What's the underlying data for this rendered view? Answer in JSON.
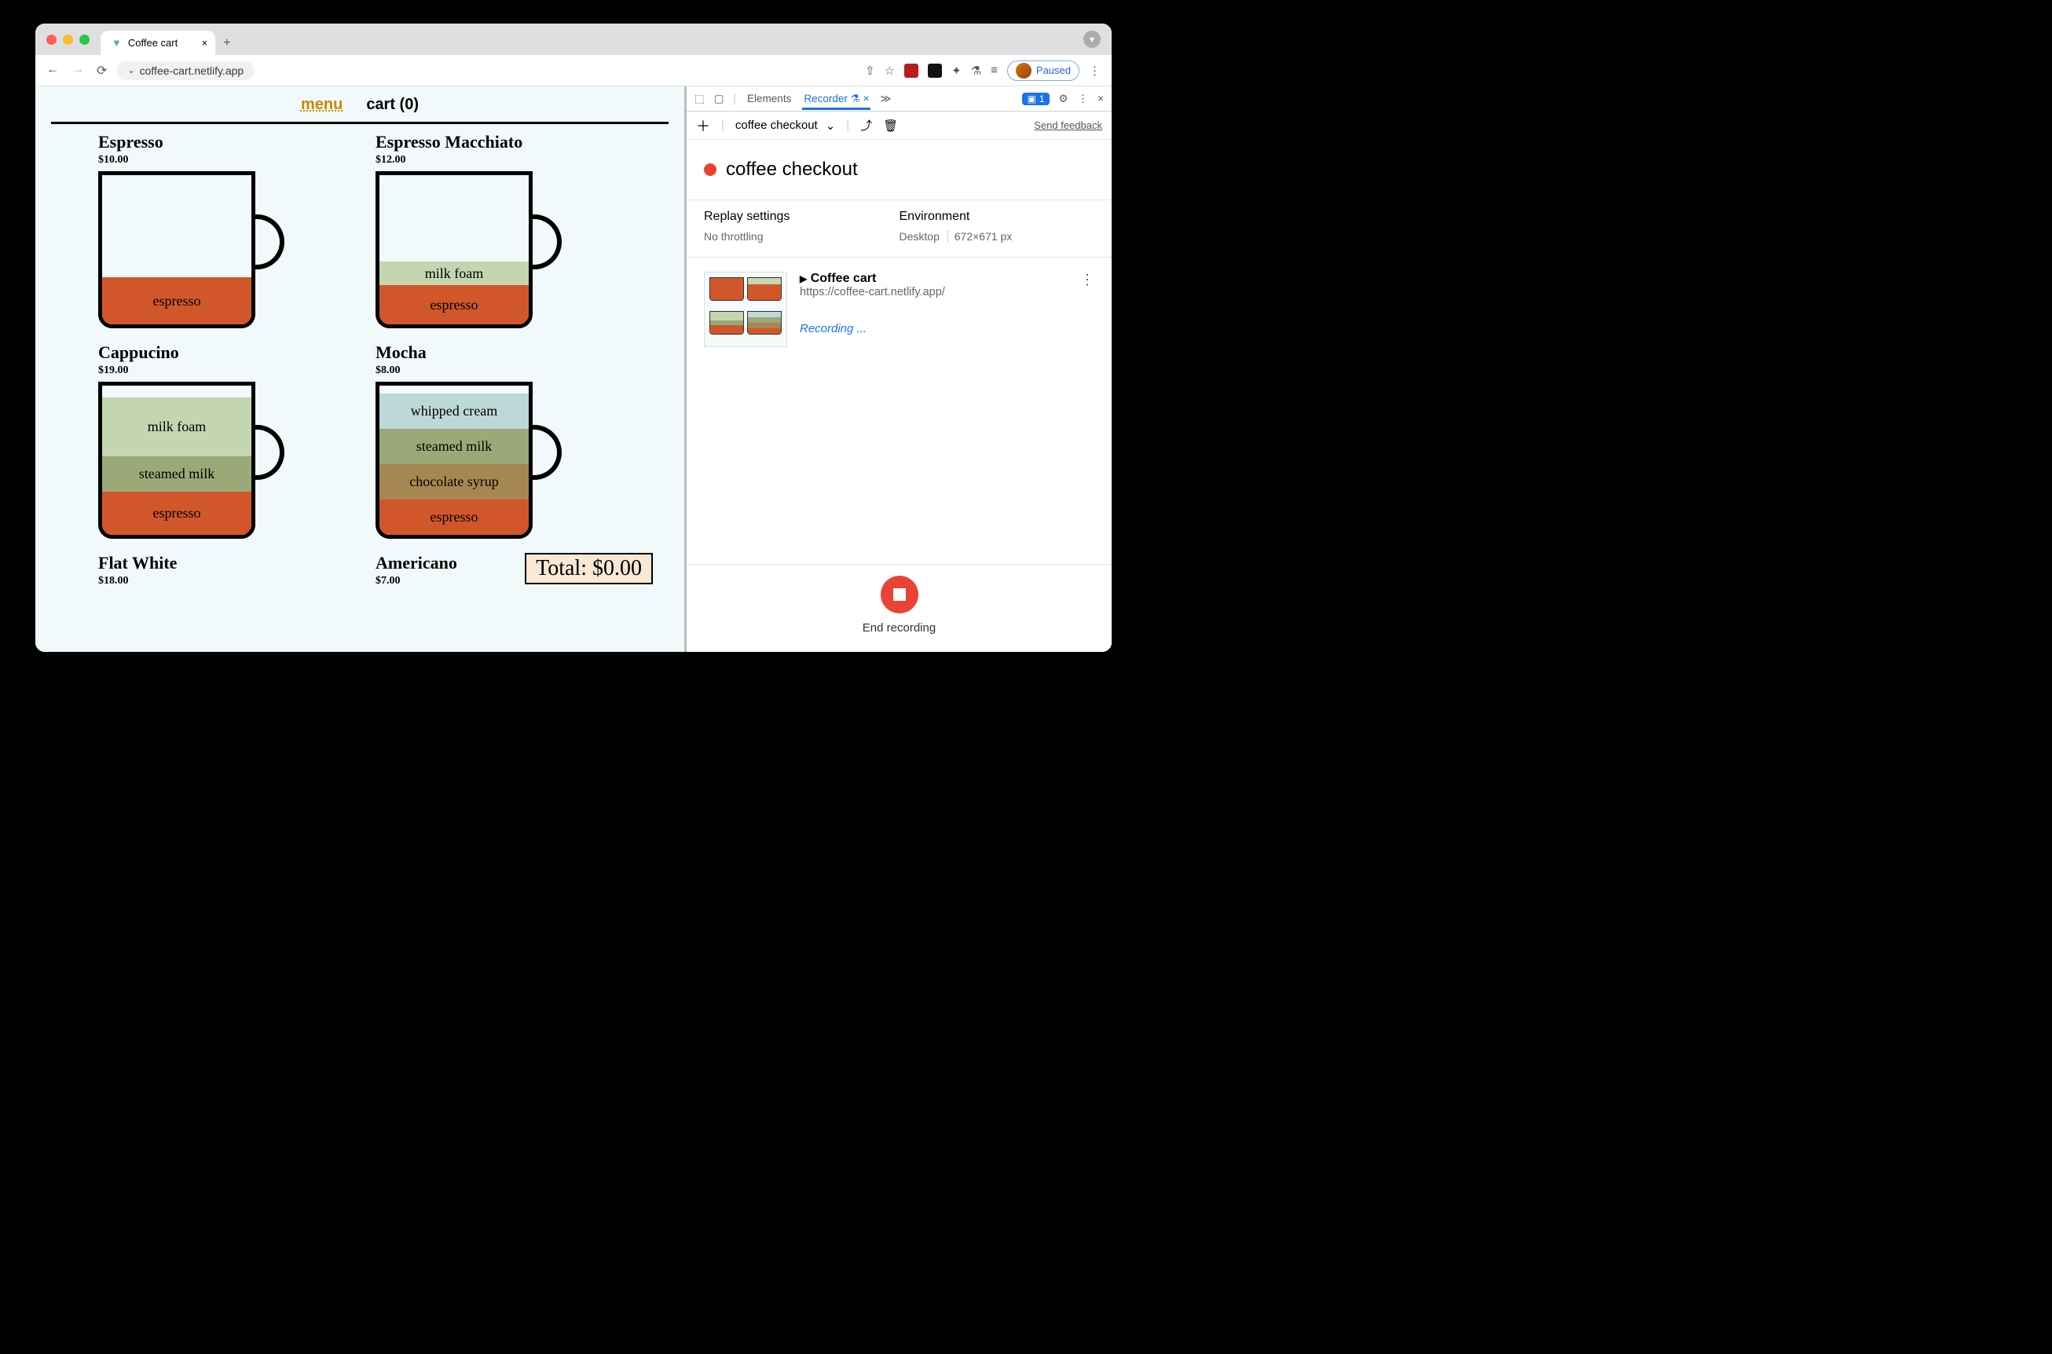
{
  "titlebar": {
    "tab_title": "Coffee cart",
    "new_tab_plus": "+"
  },
  "address": {
    "url": "coffee-cart.netlify.app",
    "paused_label": "Paused"
  },
  "app": {
    "nav_menu": "menu",
    "nav_cart": "cart (0)",
    "total_label": "Total: $0.00",
    "items": [
      {
        "name": "Espresso",
        "price": "$10.00",
        "layers": [
          {
            "h": 60,
            "cls": "espresso",
            "label": "espresso"
          }
        ]
      },
      {
        "name": "Espresso Macchiato",
        "price": "$12.00",
        "layers": [
          {
            "h": 30,
            "cls": "milkfoam",
            "label": "milk foam"
          },
          {
            "h": 50,
            "cls": "espresso",
            "label": "espresso"
          }
        ]
      },
      {
        "name": "Cappucino",
        "price": "$19.00",
        "layers": [
          {
            "h": 75,
            "cls": "milkfoam",
            "label": "milk foam"
          },
          {
            "h": 45,
            "cls": "steamed",
            "label": "steamed milk"
          },
          {
            "h": 55,
            "cls": "espresso",
            "label": "espresso"
          }
        ]
      },
      {
        "name": "Mocha",
        "price": "$8.00",
        "layers": [
          {
            "h": 45,
            "cls": "cream",
            "label": "whipped cream"
          },
          {
            "h": 45,
            "cls": "steamed",
            "label": "steamed milk"
          },
          {
            "h": 45,
            "cls": "choco",
            "label": "chocolate syrup"
          },
          {
            "h": 45,
            "cls": "espresso",
            "label": "espresso"
          }
        ]
      },
      {
        "name": "Flat White",
        "price": "$18.00",
        "layers": []
      },
      {
        "name": "Americano",
        "price": "$7.00",
        "layers": []
      }
    ]
  },
  "devtools": {
    "tab_elements": "Elements",
    "tab_recorder": "Recorder",
    "issues_count": "1",
    "more": "≫",
    "recording_name": "coffee checkout",
    "feedback": "Send feedback",
    "header": "coffee checkout",
    "settings": {
      "replay_title": "Replay settings",
      "replay_value": "No throttling",
      "env_title": "Environment",
      "env_value": "Desktop",
      "env_dims": "672×671 px"
    },
    "step": {
      "name": "Coffee cart",
      "url": "https://coffee-cart.netlify.app/",
      "status": "Recording ..."
    },
    "footer": "End recording"
  }
}
